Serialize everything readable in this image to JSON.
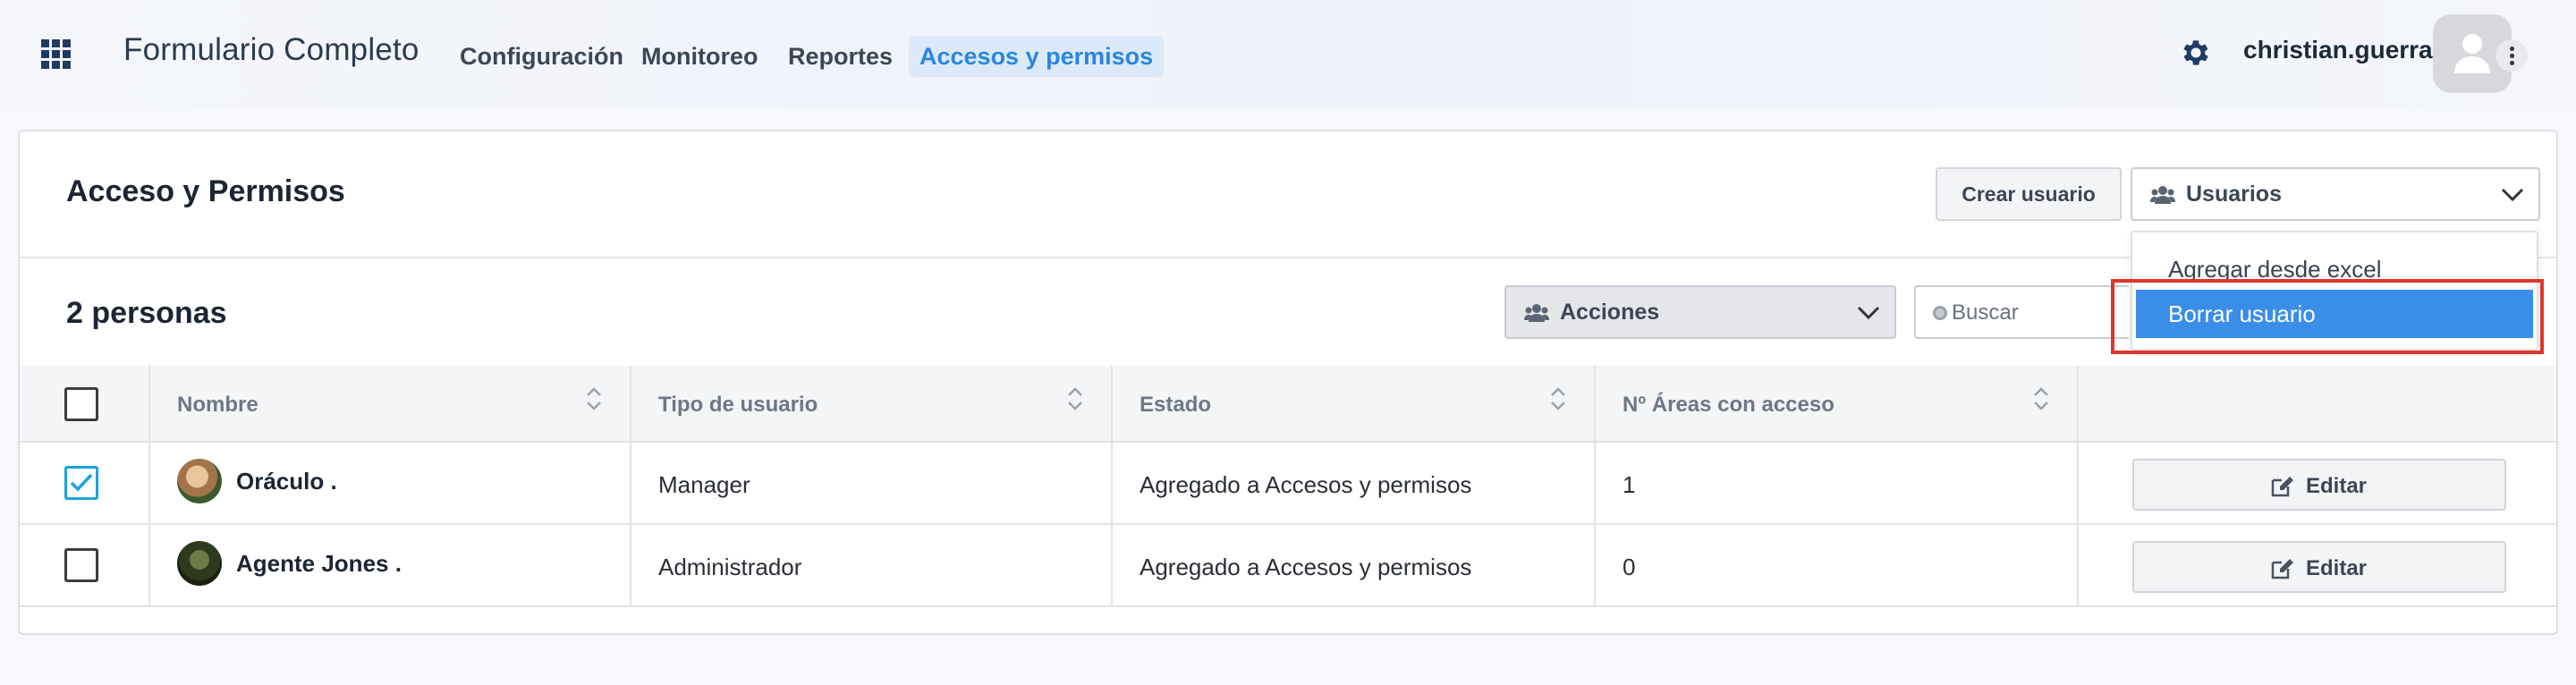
{
  "app": {
    "title": "Formulario Completo",
    "nav": [
      "Configuración",
      "Monitoreo",
      "Reportes",
      "Accesos y permisos"
    ],
    "active_nav": "Accesos y permisos",
    "username": "christian.guerra"
  },
  "page": {
    "title": "Acceso y Permisos",
    "create_button": "Crear usuario",
    "users_select": "Usuarios",
    "users_menu": [
      "Agregar desde excel",
      "Borrar usuario"
    ],
    "users_menu_selected": "Borrar usuario",
    "count_label": "2 personas",
    "actions_select": "Acciones",
    "search_placeholder": "Buscar"
  },
  "table": {
    "columns": [
      "Nombre",
      "Tipo de usuario",
      "Estado",
      "Nº Áreas con acceso"
    ],
    "edit_label": "Editar",
    "rows": [
      {
        "checked": true,
        "name": "Oráculo .",
        "type": "Manager",
        "status": "Agregado a Accesos y permisos",
        "areas": "1"
      },
      {
        "checked": false,
        "name": "Agente Jones .",
        "type": "Administrador",
        "status": "Agregado a Accesos y permisos",
        "areas": "0"
      }
    ]
  },
  "colors": {
    "accent": "#2a86e0",
    "selected_item": "#3a8ee8",
    "highlight": "#e0352b",
    "checkbox_checked": "#1aa3e0"
  },
  "icons": [
    "apps-grid-icon",
    "gear-icon",
    "user-avatar-icon",
    "kebab-menu-icon",
    "users-group-icon",
    "chevron-down-icon",
    "search-icon",
    "sort-icon",
    "checkmark-icon",
    "edit-icon"
  ]
}
